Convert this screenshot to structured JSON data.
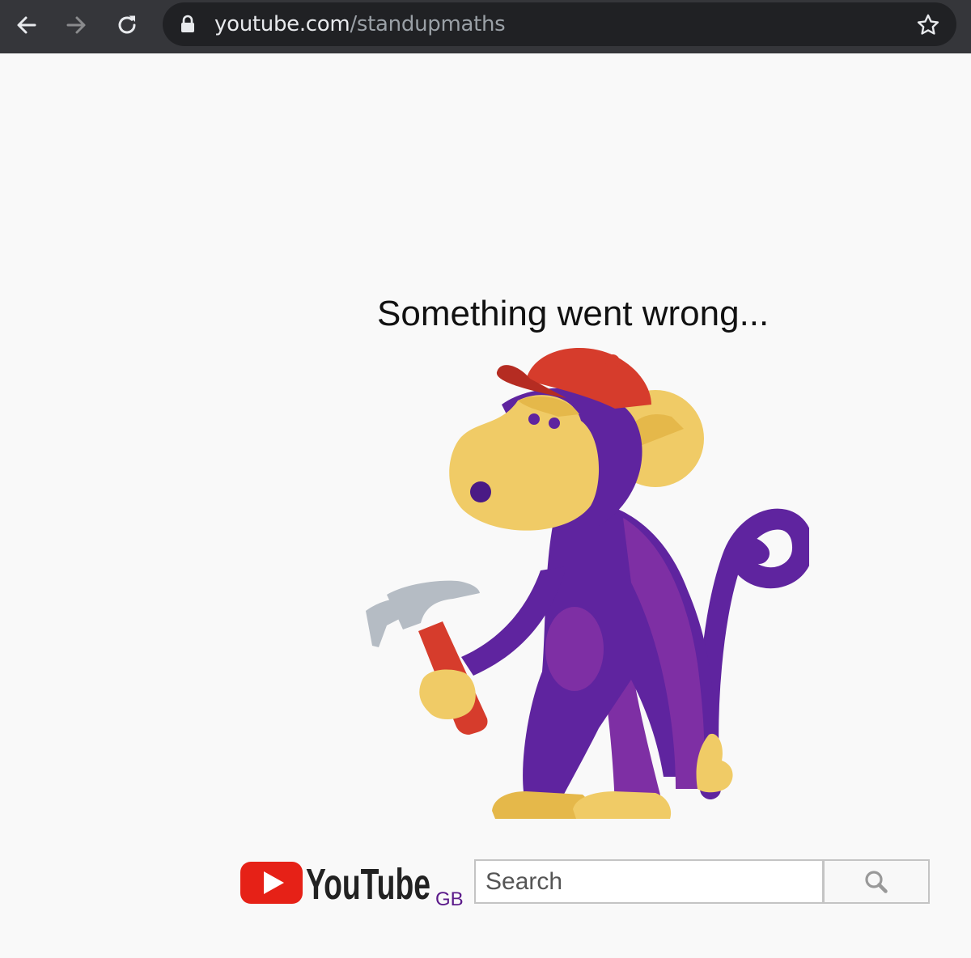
{
  "browser": {
    "url_host": "youtube.com",
    "url_path": "/standupmaths",
    "icons": {
      "back": "back-arrow-icon",
      "forward": "forward-arrow-icon",
      "reload": "reload-icon",
      "secure": "lock-icon",
      "bookmark": "star-icon"
    }
  },
  "error": {
    "message": "Something went wrong...",
    "illustration": "monkey-with-hammer-illustration"
  },
  "footer": {
    "logo_text": "YouTube",
    "region": "GB",
    "search_placeholder": "Search",
    "search_icon": "search-icon"
  },
  "colors": {
    "toolbar": "#35363a",
    "omnibox": "#202124",
    "youtube_red": "#e62117",
    "monkey_purple": "#5f249f",
    "monkey_face": "#f0cb66",
    "cap_red": "#d63c2c"
  }
}
